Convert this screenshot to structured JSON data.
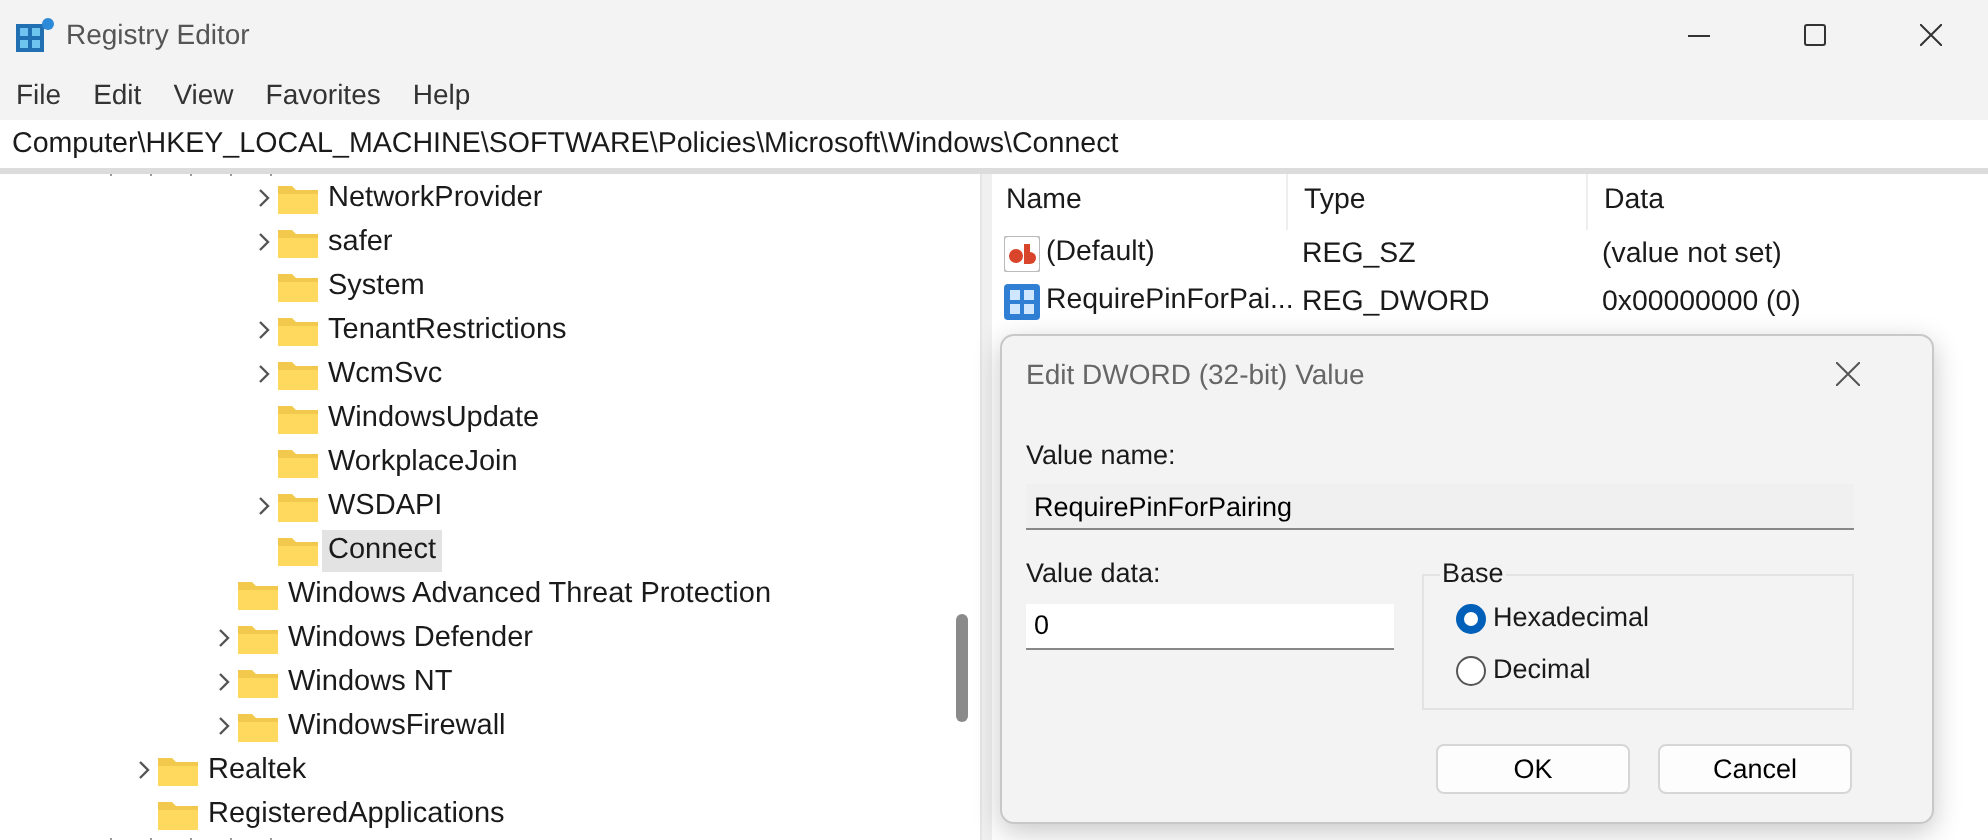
{
  "window": {
    "title": "Registry Editor"
  },
  "menu": [
    "File",
    "Edit",
    "View",
    "Favorites",
    "Help"
  ],
  "address": "Computer\\HKEY_LOCAL_MACHINE\\SOFTWARE\\Policies\\Microsoft\\Windows\\Connect",
  "tree": [
    {
      "children": [
        {
          "children": [
            {
              "children": [
                {
                  "label": "NetworkProvider",
                  "expandable": true,
                  "selected": false
                },
                {
                  "label": "safer",
                  "expandable": true,
                  "selected": false
                },
                {
                  "label": "System",
                  "expandable": false,
                  "selected": false
                },
                {
                  "label": "TenantRestrictions",
                  "expandable": true,
                  "selected": false
                },
                {
                  "label": "WcmSvc",
                  "expandable": true,
                  "selected": false
                },
                {
                  "label": "WindowsUpdate",
                  "expandable": false,
                  "selected": false
                },
                {
                  "label": "WorkplaceJoin",
                  "expandable": false,
                  "selected": false
                },
                {
                  "label": "WSDAPI",
                  "expandable": true,
                  "selected": false
                },
                {
                  "label": "Connect",
                  "expandable": false,
                  "selected": true
                }
              ]
            },
            {
              "label": "Windows Advanced Threat Protection",
              "expandable": false,
              "selected": false
            },
            {
              "label": "Windows Defender",
              "expandable": true,
              "selected": false
            },
            {
              "label": "Windows NT",
              "expandable": true,
              "selected": false
            },
            {
              "label": "WindowsFirewall",
              "expandable": true,
              "selected": false
            }
          ]
        }
      ]
    },
    {
      "label": "Realtek",
      "expandable": true,
      "selected": false
    },
    {
      "label": "RegisteredApplications",
      "expandable": false,
      "selected": false
    }
  ],
  "values": {
    "columns": [
      "Name",
      "Type",
      "Data"
    ],
    "rows": [
      {
        "kind": "string",
        "name": "(Default)",
        "type": "REG_SZ",
        "data": "(value not set)"
      },
      {
        "kind": "dword",
        "name": "RequirePinForPai...",
        "type": "REG_DWORD",
        "data": "0x00000000 (0)"
      }
    ]
  },
  "dialog": {
    "title": "Edit DWORD (32-bit) Value",
    "value_name_label": "Value name:",
    "value_name": "RequirePinForPairing",
    "value_data_label": "Value data:",
    "value_data": "0",
    "base_label": "Base",
    "base_options": [
      {
        "label": "Hexadecimal",
        "selected": true
      },
      {
        "label": "Decimal",
        "selected": false
      }
    ],
    "buttons": [
      "OK",
      "Cancel"
    ]
  }
}
